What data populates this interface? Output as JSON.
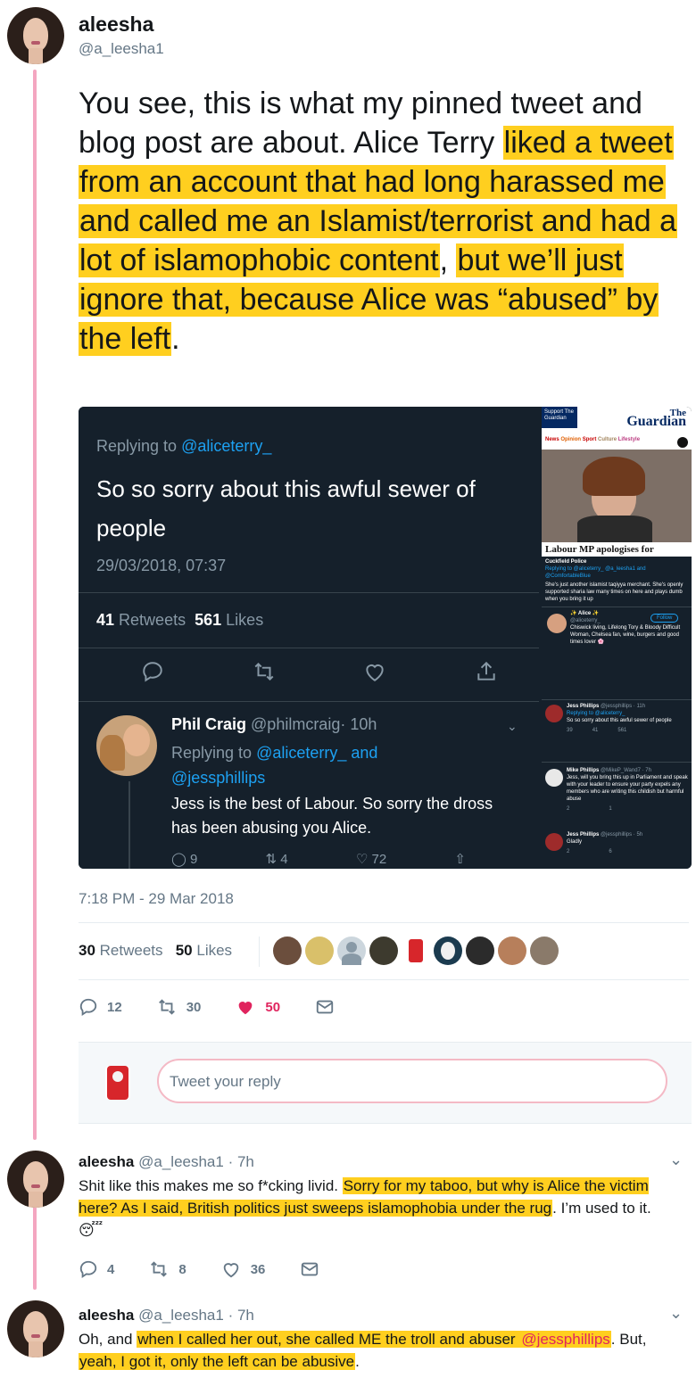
{
  "main_tweet": {
    "name": "aleesha",
    "handle": "@a_leesha1",
    "text_plain": "You see, this is what my pinned tweet and blog post are about. Alice Terry ",
    "text_highlight_1": "liked a tweet from an account that had long harassed me and called me an Islamist/terrorist and had a lot of islamophobic content",
    "text_mid": ", ",
    "text_highlight_2": "but we’ll just ignore that, because Alice was “abused” by the left",
    "text_end": ".",
    "timestamp": "7:18 PM - 29 Mar 2018",
    "retweets_count": "30",
    "retweets_label": "Retweets",
    "likes_count": "50",
    "likes_label": "Likes",
    "replies": "12",
    "retweets": "30",
    "likes": "50"
  },
  "screenshot_left": {
    "replying_label": "Replying to ",
    "replying_to": "@aliceterry_",
    "text": "So so sorry about this awful sewer of people",
    "datetime": "29/03/2018, 07:37",
    "retweets_count": "41",
    "retweets_label": "Retweets",
    "likes_count": "561",
    "likes_label": "Likes",
    "reply": {
      "name": "Phil Craig",
      "handle": "@philmcraig",
      "time": "· 10h",
      "replying_label": "Replying to ",
      "replying_to_1": "@aliceterry_",
      "and": " and",
      "replying_to_2": "@jessphillips",
      "text": "Jess is the best of Labour. So sorry the dross has been abusing you Alice.",
      "replies": "9",
      "retweets": "4",
      "likes": "72"
    }
  },
  "screenshot_right": {
    "support": "Support The Guardian",
    "logo_top": "The",
    "logo_bottom": "Guardian",
    "nav": [
      "News",
      "Opinion",
      "Sport",
      "Culture",
      "Lifestyle"
    ],
    "headline": "Labour MP apologises for",
    "t1_name": "Cuckfield Police",
    "t1_reply": "Replying to @aliceterry_ @a_leesha1 and @ComfortableBlue",
    "t1_text": "She's just another islamist taqiyya merchant. She's openly supported sharia law many times on here and plays dumb when you bring it up",
    "t2_name": "✨ Alice ✨",
    "t2_handle": "@aliceterry_",
    "t2_follow": "Follow",
    "t2_bio": "Chiswick living, Lifelong Tory & Bloody Difficult Woman, Chelsea fan, wine, burgers and good times lover 🌸",
    "t3_name": "Jess Phillips",
    "t3_handle": "@jessphillips · 11h",
    "t3_reply": "Replying to @aliceterry_",
    "t3_text": "So so sorry about this awful sewer of people",
    "t3_stats": [
      "39",
      "41",
      "561"
    ],
    "t4_name": "Mike Phillips",
    "t4_handle": "@MikeP_Wand7 · 7h",
    "t4_text": "Jess, will you bring this up in Parliament and speak with your leader to ensure your party expels any members who are writing this childish but harmful abuse",
    "t4_stats": [
      "2",
      "",
      "1"
    ],
    "t5_name": "Jess Phillips",
    "t5_handle": "@jessphillips · 5h",
    "t5_text": "Gladly",
    "t5_stats": [
      "2",
      "",
      "6"
    ]
  },
  "reply_box": {
    "placeholder": "Tweet your reply"
  },
  "reply1": {
    "name": "aleesha",
    "handle": "@a_leesha1",
    "time": "· 7h",
    "text_a": "Shit like this makes me so f*cking livid. ",
    "text_hl": "Sorry for my taboo, but why is Alice the victim here? As I said, British politics just sweeps islamophobia under the rug",
    "text_b": ". I’m used to it. ",
    "emoji": "😴",
    "replies": "4",
    "retweets": "8",
    "likes": "36"
  },
  "reply2": {
    "name": "aleesha",
    "handle": "@a_leesha1",
    "time": "· 7h",
    "text_a": "Oh, and ",
    "text_hl1": "when I called her out, she called ME the troll and abuser ",
    "mention": "@jessphillips",
    "text_b": ". But, ",
    "text_hl2": "yeah, I got it, only the left can be abusive",
    "text_c": "."
  },
  "colors": {
    "highlight": "#ffcf1f",
    "link": "#1b95e0",
    "like_red": "#e0245e",
    "thread_pink": "#f4a6c0",
    "dark_bg": "#15202b"
  }
}
